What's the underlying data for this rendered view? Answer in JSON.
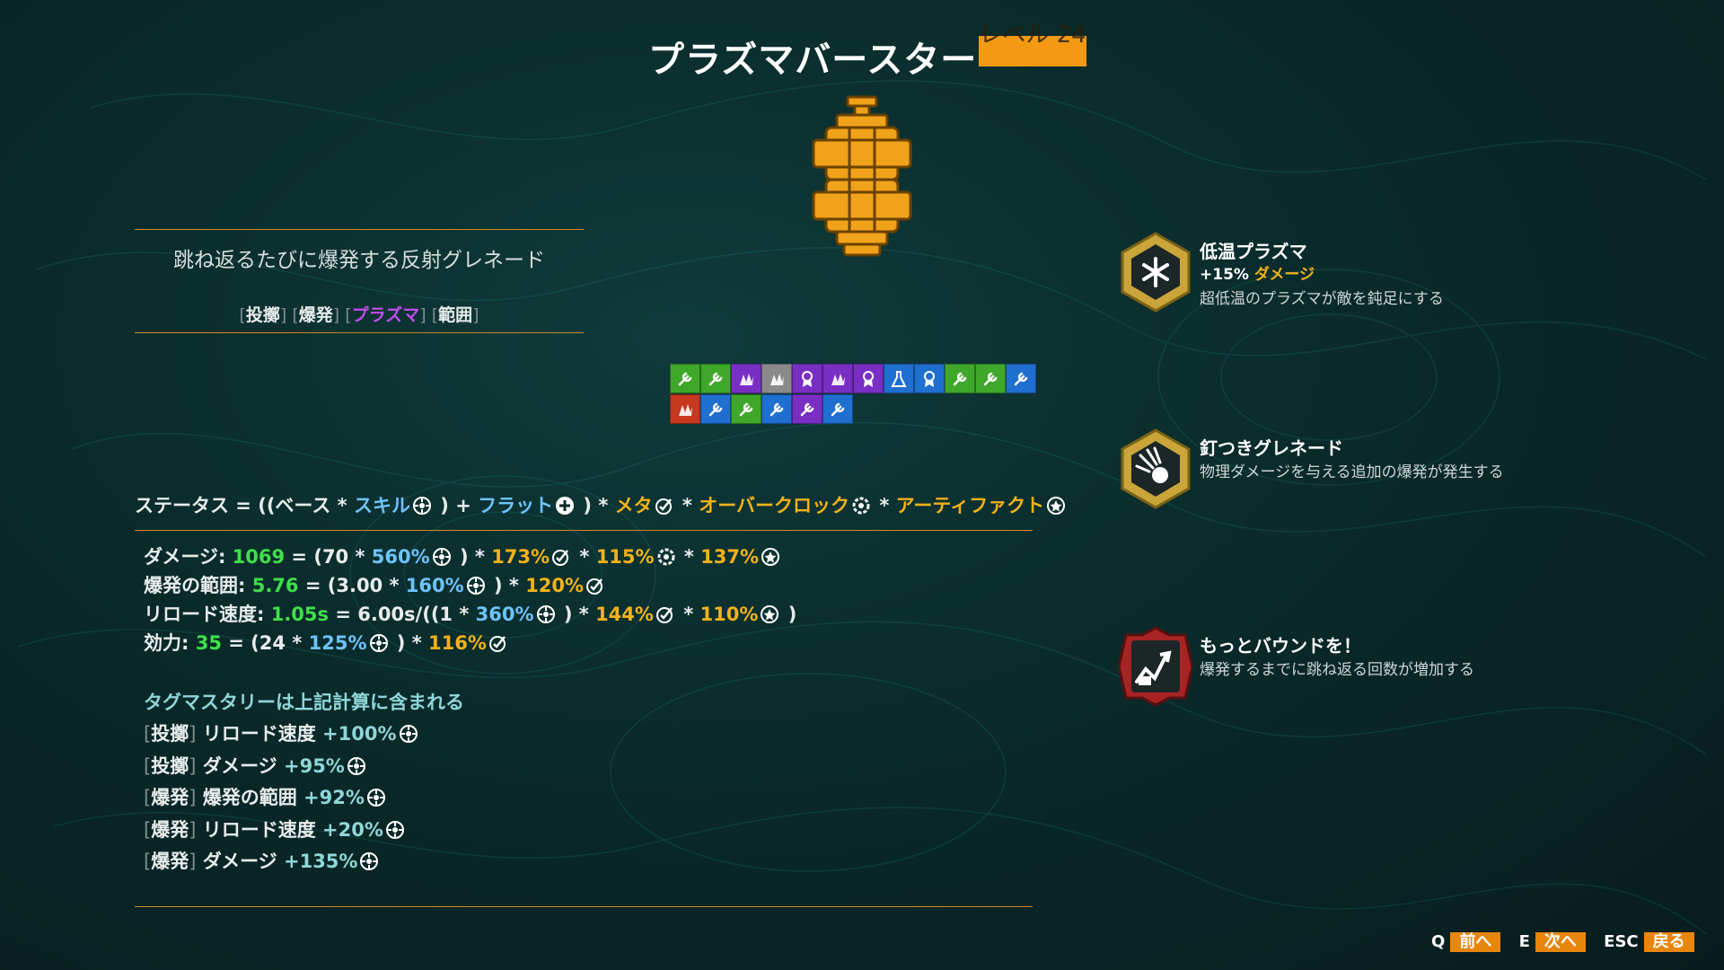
{
  "header": {
    "title": "プラズマバースター",
    "level_label": "レベル 24"
  },
  "description": {
    "text": "跳ね返るたびに爆発する反射グレネード",
    "tags": [
      {
        "label": "投擲",
        "color": "#e8ecec"
      },
      {
        "label": "爆発",
        "color": "#e8ecec"
      },
      {
        "label": "プラズマ",
        "color": "#c34cf0"
      },
      {
        "label": "範囲",
        "color": "#e8ecec"
      }
    ]
  },
  "skill_icons": {
    "row1": [
      "green-wrench",
      "green-wrench",
      "purple-claw",
      "grey-claw",
      "purple-medal",
      "purple-claw",
      "purple-medal",
      "blue-flask",
      "blue-medal",
      "green-wrench",
      "green-wrench",
      "blue-wrench"
    ],
    "row2": [
      "red-claw",
      "blue-wrench",
      "green-wrench",
      "blue-wrench",
      "purple-wrench",
      "blue-wrench"
    ]
  },
  "formula": {
    "status": "ステータス",
    "eq_open": " = ((ベース * ",
    "skill": "スキル",
    "plus": " ) + ",
    "flat": "フラット",
    "times_meta": " ) * ",
    "meta": "メタ",
    "times_over": " * ",
    "overclock": "オーバークロック",
    "times_art": " * ",
    "artifact": "アーティファクト"
  },
  "stats": [
    {
      "label": "ダメージ: ",
      "value": "1069",
      "expr_a": " = (70 * ",
      "skill_pct": "560%",
      "expr_b": " ) * ",
      "meta_pct": "173%",
      "over_pct": "115%",
      "art_pct": "137%"
    },
    {
      "label": "爆発の範囲: ",
      "value": "5.76",
      "expr_a": " = (3.00 * ",
      "skill_pct": "160%",
      "expr_b": " ) * ",
      "meta_pct": "120%"
    },
    {
      "label": "リロード速度: ",
      "value": "1.05s",
      "expr_a": " = 6.00s/((1 * ",
      "skill_pct": "360%",
      "expr_b": " ) * ",
      "meta_pct": "144%",
      "art_pct": "110%",
      "expr_end": " )"
    },
    {
      "label": "効力: ",
      "value": "35",
      "expr_a": " = (24 * ",
      "skill_pct": "125%",
      "expr_b": " ) * ",
      "meta_pct": "116%"
    }
  ],
  "mastery": {
    "title": "タグマスタリーは上記計算に含まれる",
    "lines": [
      {
        "tag": "投擲",
        "text": "リロード速度 ",
        "value": "+100%"
      },
      {
        "tag": "投擲",
        "text": "ダメージ ",
        "value": "+95%"
      },
      {
        "tag": "爆発",
        "text": "爆発の範囲 ",
        "value": "+92%"
      },
      {
        "tag": "爆発",
        "text": "リロード速度 ",
        "value": "+20%"
      },
      {
        "tag": "爆発",
        "text": "ダメージ ",
        "value": "+135%"
      }
    ]
  },
  "perks": [
    {
      "title": "低温プラズマ",
      "sub_value": "+15% ",
      "sub_stat": "ダメージ",
      "desc": "超低温のプラズマが敵を鈍足にする",
      "icon": "snowflake-icon"
    },
    {
      "title": "釘つきグレネード",
      "desc": "物理ダメージを与える追加の爆発が発生する",
      "icon": "nail-burst-icon"
    },
    {
      "title": "もっとバウンドを！",
      "desc": "爆発するまでに跳ね返る回数が増加する",
      "icon": "bounce-icon"
    }
  ],
  "footer": {
    "prev_key": "Q",
    "prev_label": "前へ",
    "next_key": "E",
    "next_label": "次へ",
    "back_key": "ESC",
    "back_label": "戻る"
  },
  "colors": {
    "accent": "#f39a12",
    "skill_blue": "#6ec3ff",
    "meta_gold": "#f2b21a",
    "value_green": "#3fe04a",
    "plasma_purple": "#c34cf0"
  }
}
